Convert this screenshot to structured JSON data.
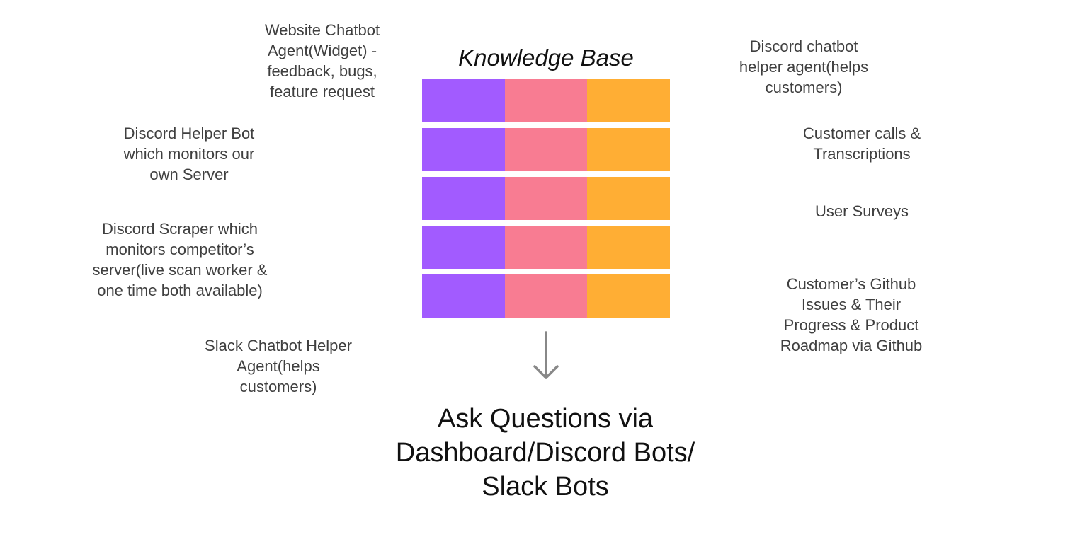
{
  "diagram": {
    "title": "Knowledge Base",
    "left_sources": [
      "Website Chatbot\nAgent(Widget) -\nfeedback, bugs,\nfeature request",
      "Discord Helper Bot\nwhich monitors our\nown Server",
      "Discord Scraper which\nmonitors competitor’s\nserver(live scan worker &\none time both available)",
      "Slack Chatbot Helper\nAgent(helps\ncustomers)"
    ],
    "right_sources": [
      "Discord chatbot\nhelper agent(helps\ncustomers)",
      "Customer calls &\nTranscriptions",
      "User Surveys",
      "Customer’s Github\nIssues & Their\nProgress & Product\nRoadmap via Github"
    ],
    "kb_rows": 5,
    "kb_colors": [
      "#a25bff",
      "#f87c92",
      "#ffae34"
    ],
    "arrow_color": "#888888",
    "output": "Ask Questions via\nDashboard/Discord Bots/\nSlack Bots"
  }
}
